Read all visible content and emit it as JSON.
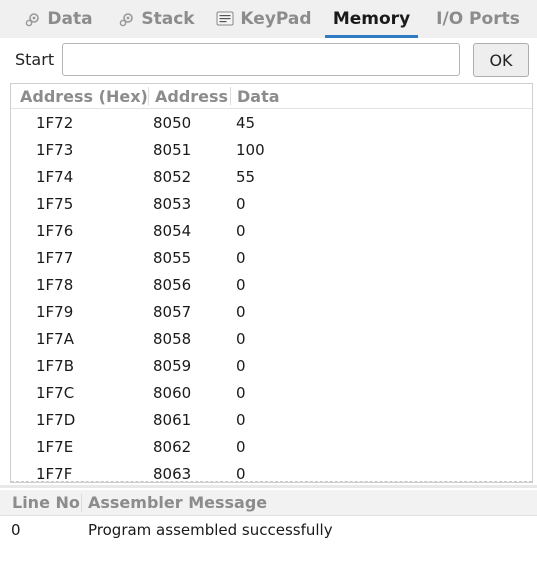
{
  "tabs": [
    {
      "label": "Data",
      "icon": "data-icon",
      "active": false
    },
    {
      "label": "Stack",
      "icon": "stack-icon",
      "active": false
    },
    {
      "label": "KeyPad",
      "icon": "keypad-icon",
      "active": false
    },
    {
      "label": "Memory",
      "icon": "",
      "active": true
    },
    {
      "label": "I/O Ports",
      "icon": "",
      "active": false
    }
  ],
  "start": {
    "label": "Start",
    "value": "",
    "ok_label": "OK"
  },
  "memory_table": {
    "headers": [
      "Address (Hex)",
      "Address",
      "Data"
    ],
    "rows": [
      {
        "hex": "1F72",
        "addr": "8050",
        "data": "45"
      },
      {
        "hex": "1F73",
        "addr": "8051",
        "data": "100"
      },
      {
        "hex": "1F74",
        "addr": "8052",
        "data": "55"
      },
      {
        "hex": "1F75",
        "addr": "8053",
        "data": "0"
      },
      {
        "hex": "1F76",
        "addr": "8054",
        "data": "0"
      },
      {
        "hex": "1F77",
        "addr": "8055",
        "data": "0"
      },
      {
        "hex": "1F78",
        "addr": "8056",
        "data": "0"
      },
      {
        "hex": "1F79",
        "addr": "8057",
        "data": "0"
      },
      {
        "hex": "1F7A",
        "addr": "8058",
        "data": "0"
      },
      {
        "hex": "1F7B",
        "addr": "8059",
        "data": "0"
      },
      {
        "hex": "1F7C",
        "addr": "8060",
        "data": "0"
      },
      {
        "hex": "1F7D",
        "addr": "8061",
        "data": "0"
      },
      {
        "hex": "1F7E",
        "addr": "8062",
        "data": "0"
      },
      {
        "hex": "1F7F",
        "addr": "8063",
        "data": "0"
      }
    ]
  },
  "log_table": {
    "headers": [
      "Line No",
      "Assembler Message"
    ],
    "rows": [
      {
        "line": "0",
        "message": "Program assembled successfully"
      }
    ]
  },
  "colors": {
    "accent": "#2f7cc4",
    "header_text": "#8c8c8c"
  }
}
